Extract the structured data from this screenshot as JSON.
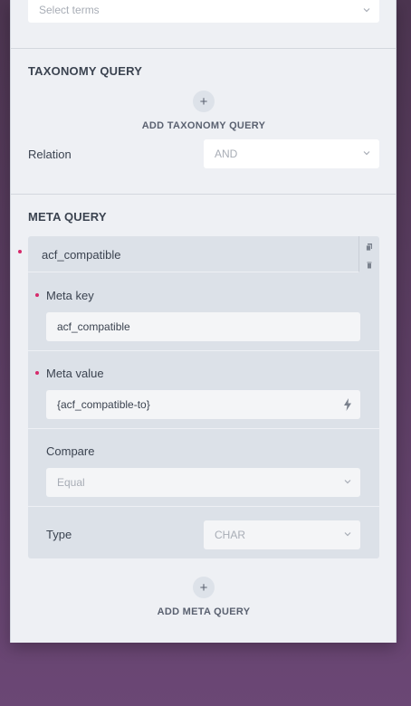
{
  "terms_select": {
    "placeholder": "Select terms"
  },
  "taxonomy_query": {
    "title": "TAXONOMY QUERY",
    "add_button_icon": "+",
    "add_label": "ADD TAXONOMY QUERY",
    "relation_label": "Relation",
    "relation_value": "AND"
  },
  "meta_query": {
    "title": "META QUERY",
    "item": {
      "header": "acf_compatible",
      "meta_key_label": "Meta key",
      "meta_key_value": "acf_compatible",
      "meta_value_label": "Meta value",
      "meta_value_value": "{acf_compatible-to}",
      "compare_label": "Compare",
      "compare_value": "Equal",
      "type_label": "Type",
      "type_value": "CHAR"
    },
    "add_button_icon": "+",
    "add_label": "ADD META QUERY"
  },
  "colors": {
    "panel_bg": "#eef0f4",
    "required_dot": "#d62a6b",
    "repeater_bg": "#dce1e8",
    "background": "#5b3d62"
  },
  "icons": [
    "chevron-down-icon",
    "plus-icon",
    "copy-icon",
    "trash-icon",
    "dynamic-tag-icon"
  ]
}
